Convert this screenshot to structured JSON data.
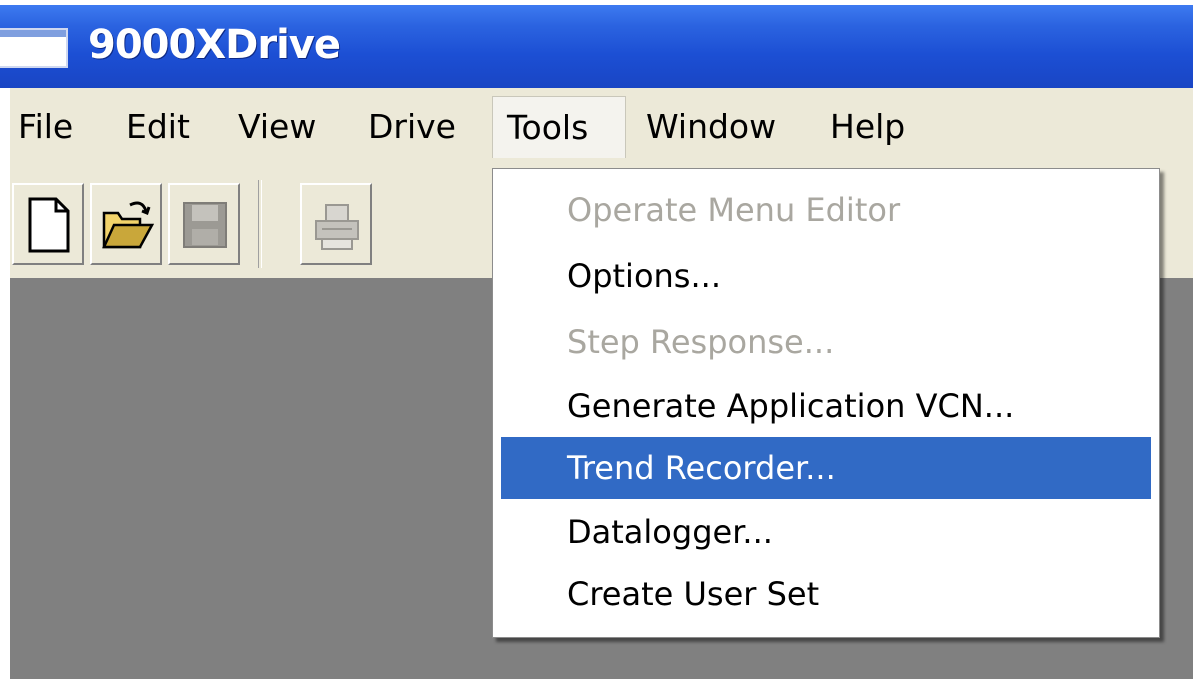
{
  "window": {
    "title": "9000XDrive"
  },
  "menubar": {
    "items": [
      {
        "label": "File"
      },
      {
        "label": "Edit"
      },
      {
        "label": "View"
      },
      {
        "label": "Drive"
      },
      {
        "label": "Tools"
      },
      {
        "label": "Window"
      },
      {
        "label": "Help"
      }
    ],
    "open_menu": "Tools"
  },
  "toolbar": {
    "buttons": [
      {
        "icon": "new-document-icon",
        "enabled": true
      },
      {
        "icon": "open-folder-icon",
        "enabled": true
      },
      {
        "icon": "save-disk-icon",
        "enabled": false
      },
      {
        "icon": "print-icon",
        "enabled": false
      }
    ]
  },
  "tools_menu": {
    "items": [
      {
        "label": "Operate Menu Editor",
        "enabled": false
      },
      {
        "label": "Options...",
        "enabled": true
      },
      {
        "label": "Step Response...",
        "enabled": false
      },
      {
        "label": "Generate Application VCN...",
        "enabled": true
      },
      {
        "label": "Trend Recorder...",
        "enabled": true,
        "highlighted": true
      },
      {
        "label": "Datalogger...",
        "enabled": true
      },
      {
        "label": "Create User Set",
        "enabled": true
      }
    ]
  },
  "colors": {
    "titlebar": "#1c4fd4",
    "menu_highlight": "#316ac5",
    "client_area": "#808080",
    "chrome": "#ece9d8",
    "disabled_text": "#a9a7a0"
  }
}
